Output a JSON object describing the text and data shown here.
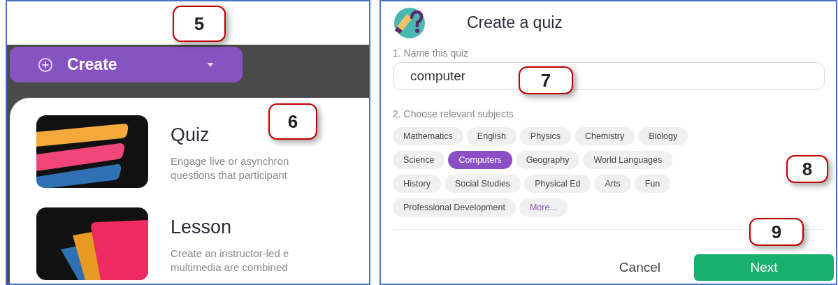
{
  "left_panel": {
    "create_button": {
      "label": "Create"
    },
    "items": [
      {
        "kind": "quiz",
        "title": "Quiz",
        "description": [
          "Engage live or asynchron",
          "questions that participant"
        ]
      },
      {
        "kind": "lesson",
        "title": "Lesson",
        "description": [
          "Create an instructor-led e",
          "multimedia are combined"
        ]
      }
    ]
  },
  "dialog": {
    "title": "Create a quiz",
    "name_field": {
      "label": "1. Name this quiz",
      "value": "computer"
    },
    "subjects": {
      "label": "2. Choose relevant subjects",
      "chips": [
        {
          "label": "Mathematics",
          "selected": false,
          "kind": "subject"
        },
        {
          "label": "English",
          "selected": false,
          "kind": "subject"
        },
        {
          "label": "Physics",
          "selected": false,
          "kind": "subject"
        },
        {
          "label": "Chemistry",
          "selected": false,
          "kind": "subject"
        },
        {
          "label": "Biology",
          "selected": false,
          "kind": "subject"
        },
        {
          "label": "Science",
          "selected": false,
          "kind": "subject"
        },
        {
          "label": "Computers",
          "selected": true,
          "kind": "subject"
        },
        {
          "label": "Geography",
          "selected": false,
          "kind": "subject"
        },
        {
          "label": "World Languages",
          "selected": false,
          "kind": "subject"
        },
        {
          "label": "History",
          "selected": false,
          "kind": "subject"
        },
        {
          "label": "Social Studies",
          "selected": false,
          "kind": "subject"
        },
        {
          "label": "Physical Ed",
          "selected": false,
          "kind": "subject"
        },
        {
          "label": "Arts",
          "selected": false,
          "kind": "subject"
        },
        {
          "label": "Fun",
          "selected": false,
          "kind": "subject"
        },
        {
          "label": "Professional Development",
          "selected": false,
          "kind": "subject"
        },
        {
          "label": "More...",
          "selected": false,
          "kind": "more"
        }
      ]
    },
    "buttons": {
      "cancel": "Cancel",
      "next": "Next"
    }
  },
  "callouts": [
    "5",
    "6",
    "7",
    "8",
    "9"
  ]
}
